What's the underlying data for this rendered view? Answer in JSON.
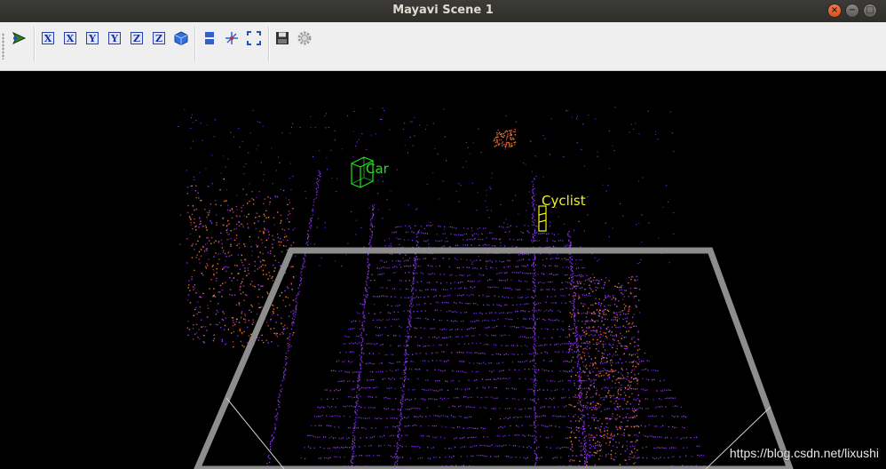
{
  "window": {
    "title": "Mayavi Scene 1",
    "minimize": "−",
    "maximize": "□",
    "close": "×"
  },
  "toolbar": {
    "items": [
      {
        "id": "mayavi-pipeline",
        "glyph": "➤"
      },
      {
        "id": "view-x-plus",
        "glyph": "X"
      },
      {
        "id": "view-x-minus",
        "glyph": "X"
      },
      {
        "id": "view-y-plus",
        "glyph": "Y"
      },
      {
        "id": "view-y-minus",
        "glyph": "Y"
      },
      {
        "id": "view-z-plus",
        "glyph": "Z"
      },
      {
        "id": "view-z-minus",
        "glyph": "Z"
      },
      {
        "id": "isometric",
        "glyph": "cube"
      },
      {
        "id": "parallel-projection",
        "glyph": "bars"
      },
      {
        "id": "axes-indicator",
        "glyph": "axes"
      },
      {
        "id": "fullscreen",
        "glyph": "expand"
      },
      {
        "id": "save",
        "glyph": "floppy"
      },
      {
        "id": "configure",
        "glyph": "gear"
      }
    ]
  },
  "scene": {
    "labels": [
      {
        "text": "Car",
        "color": "#22e01e"
      },
      {
        "text": "Cyclist",
        "color": "#f2f21a"
      }
    ],
    "colors": {
      "car_box": "#22e01e",
      "cyclist_box": "#f2f21a",
      "grid_frame": "#8d8d8d",
      "road_points": "#7a2fe0",
      "side_points": "#e8641a"
    }
  },
  "watermark": "https://blog.csdn.net/lixushi"
}
